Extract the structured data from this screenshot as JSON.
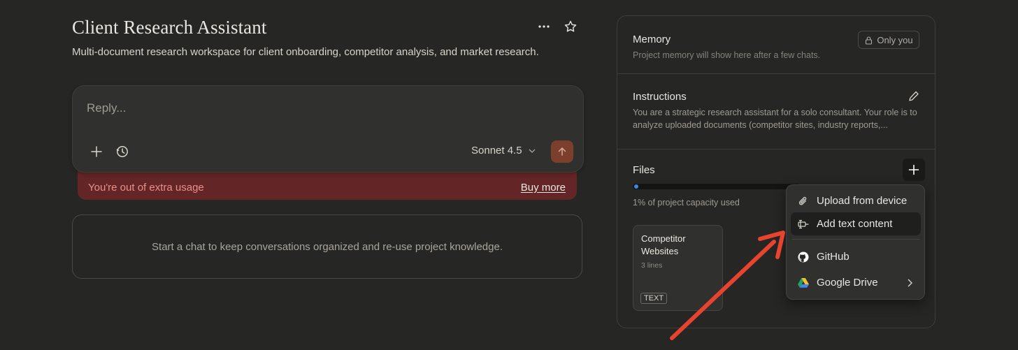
{
  "project": {
    "title": "Client Research Assistant",
    "description": "Multi-document research workspace for client onboarding, competitor analysis, and market research."
  },
  "composer": {
    "placeholder": "Reply...",
    "model": "Sonnet 4.5"
  },
  "usage_banner": {
    "message": "You're out of extra usage",
    "action": "Buy more"
  },
  "empty_state": "Start a chat to keep conversations organized and re-use project knowledge.",
  "sidebar": {
    "memory": {
      "title": "Memory",
      "visibility": "Only you",
      "note": "Project memory will show here after a few chats."
    },
    "instructions": {
      "title": "Instructions",
      "text": "You are a strategic research assistant for a solo consultant. Your role is to analyze uploaded documents (competitor sites, industry reports,..."
    },
    "files": {
      "title": "Files",
      "capacity_percent": 1,
      "capacity_text": "1% of project capacity used",
      "items": [
        {
          "name": "Competitor Websites",
          "lines": "3 lines",
          "type": "TEXT"
        }
      ]
    }
  },
  "add_menu": {
    "items": [
      {
        "label": "Upload from device",
        "icon": "paperclip-icon"
      },
      {
        "label": "Add text content",
        "icon": "text-content-icon",
        "active": true
      },
      {
        "label": "GitHub",
        "icon": "github-icon"
      },
      {
        "label": "Google Drive",
        "icon": "google-drive-icon",
        "submenu": true
      }
    ]
  },
  "colors": {
    "background": "#262624",
    "send_button": "#7c3f2c",
    "banner": "#632525",
    "annotation_arrow": "#e8432f",
    "capacity_fill": "#3e86e0"
  }
}
